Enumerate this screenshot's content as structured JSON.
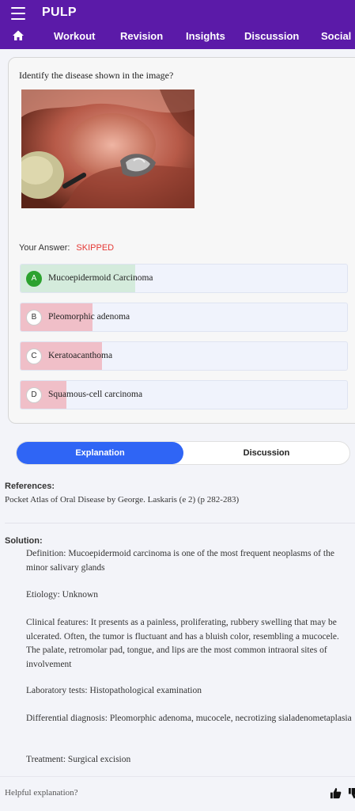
{
  "app": {
    "title": "PULP"
  },
  "nav": {
    "tabs": [
      "Workout",
      "Revision",
      "Insights",
      "Discussion",
      "Social"
    ]
  },
  "question": {
    "text": "Identify the disease shown in the image?",
    "answer_label": "Your Answer:",
    "answer_value": "SKIPPED",
    "options": [
      {
        "letter": "A",
        "text": "Mucoepidermoid Carcinoma",
        "correct": true,
        "fill_pct": 35,
        "color": "#d4ebdc"
      },
      {
        "letter": "B",
        "text": "Pleomorphic adenoma",
        "correct": false,
        "fill_pct": 22,
        "color": "#f0bfc8"
      },
      {
        "letter": "C",
        "text": "Keratoacanthoma",
        "correct": false,
        "fill_pct": 25,
        "color": "#f0bfc8"
      },
      {
        "letter": "D",
        "text": "Squamous-cell carcinoma",
        "correct": false,
        "fill_pct": 14,
        "color": "#f0bfc8"
      }
    ]
  },
  "toggle": {
    "active": "Explanation",
    "inactive": "Discussion"
  },
  "references": {
    "heading": "References:",
    "text": "Pocket Atlas of Oral Disease by George. Laskaris (e 2) (p 282-283)"
  },
  "solution": {
    "heading": "Solution:",
    "definition": "Definition: Mucoepidermoid carcinoma is one of the most frequent neoplasms of the minor salivary glands",
    "etiology": "Etiology: Unknown",
    "clinical": "Clinical features: It presents as a painless, proliferating, rubbery swelling that may be ulcerated. Often, the tumor is fluctuant and has a bluish color, resembling a mucocele. The palate, retromolar pad, tongue, and lips are the most common intraoral sites of involvement",
    "lab": "Laboratory tests: Histopathological examination",
    "differential": "Differential diagnosis: Pleomorphic adenoma, mucocele, necrotizing sialadenometaplasia",
    "treatment": "Treatment: Surgical excision"
  },
  "footer": {
    "question": "Helpful explanation?"
  },
  "colors": {
    "appbar": "#5b1aa8",
    "accent": "#2f65f5",
    "correct": "#2ca22f",
    "skipped": "#e53935"
  }
}
